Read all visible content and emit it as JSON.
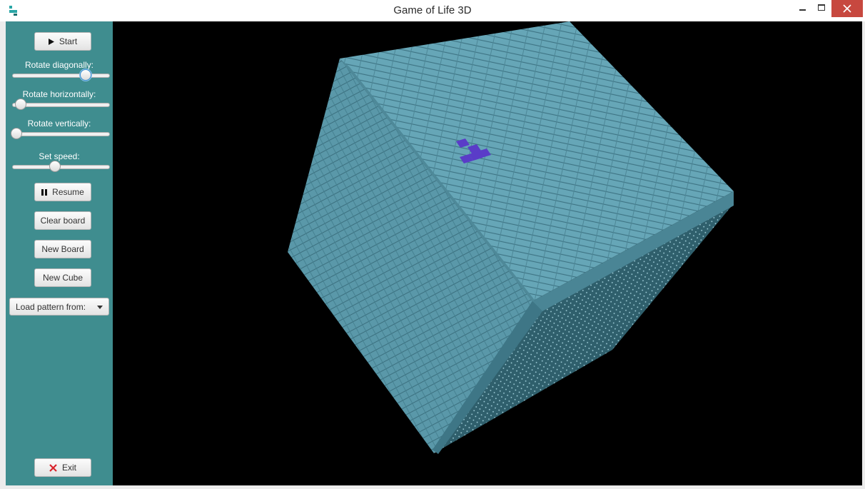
{
  "window": {
    "title": "Game of Life 3D",
    "app_icon": "app-logo-icon",
    "controls": [
      "minimize-icon",
      "maximize-icon",
      "close-icon"
    ]
  },
  "sidebar": {
    "start_button": {
      "label": "Start",
      "icon": "play-icon"
    },
    "sliders": [
      {
        "label": "Rotate diagonally:",
        "value_fraction": 0.75
      },
      {
        "label": "Rotate horizontally:",
        "value_fraction": 0.08
      },
      {
        "label": "Rotate vertically:",
        "value_fraction": 0.0
      },
      {
        "label": "Set speed:",
        "value_fraction": 0.43
      }
    ],
    "resume_button": {
      "label": "Resume",
      "icon": "pause-icon"
    },
    "clear_board_button": {
      "label": "Clear board"
    },
    "new_board_button": {
      "label": "New Board"
    },
    "new_cube_button": {
      "label": "New Cube"
    },
    "load_pattern": {
      "selected": "Load pattern from:"
    },
    "exit_button": {
      "label": "Exit",
      "icon": "red-x-icon"
    }
  },
  "viewport": {
    "background_color": "#000000",
    "cube_color": "#5f9eae",
    "live_cell_color": "#5a3cc8",
    "sidebar_color": "#3f8d8f"
  }
}
